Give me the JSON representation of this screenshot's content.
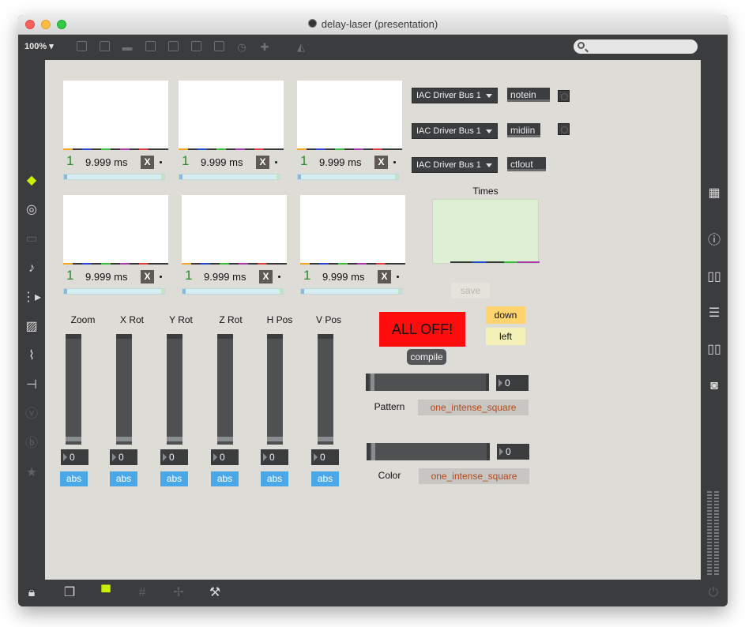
{
  "window": {
    "title": "delay-laser (presentation)",
    "zoom": "100%"
  },
  "toolbar": {
    "icons": [
      "presentation-icon",
      "text-icon",
      "comment-icon",
      "object-x-icon",
      "circle-icon",
      "play-icon",
      "dash-icon",
      "dial-icon",
      "plus-icon",
      "paint-bucket-icon"
    ]
  },
  "search": {
    "placeholder": ""
  },
  "leftbar": {
    "icons": [
      "cube-icon",
      "target-icon",
      "rack-icon",
      "note-icon",
      "sequencer-icon",
      "image-icon",
      "paperclip-icon",
      "plug-icon",
      "v-icon",
      "b-icon",
      "star-icon"
    ]
  },
  "rightbar": {
    "icons": [
      "grid-icon",
      "info-icon",
      "book-open-icon",
      "list-icon",
      "book-icon",
      "camera-icon"
    ]
  },
  "bottombar": {
    "icons": [
      "lock-icon",
      "windows-icon",
      "presentation-mode-icon",
      "grid-icon",
      "cursor-plus-icon",
      "wrench-icon",
      "power-icon"
    ]
  },
  "scopes": [
    {
      "num": "1",
      "ms": "9.999 ms",
      "x": "X"
    },
    {
      "num": "1",
      "ms": "9.999 ms",
      "x": "X"
    },
    {
      "num": "1",
      "ms": "9.999 ms",
      "x": "X"
    },
    {
      "num": "1",
      "ms": "9.999 ms",
      "x": "X"
    },
    {
      "num": "1",
      "ms": "9.999 ms",
      "x": "X"
    },
    {
      "num": "1",
      "ms": "9.999 ms",
      "x": "X"
    }
  ],
  "midi": {
    "rows": [
      {
        "device": "IAC Driver Bus 1",
        "object": "notein"
      },
      {
        "device": "IAC Driver Bus 1",
        "object": "midiin"
      },
      {
        "device": "IAC Driver Bus 1",
        "object": "ctlout"
      }
    ]
  },
  "times": {
    "label": "Times"
  },
  "buttons": {
    "save": "save",
    "all_off": "ALL OFF!",
    "compile": "compile",
    "down": "down",
    "left": "left"
  },
  "sliders": [
    {
      "label": "Zoom",
      "value": "0",
      "mode": "abs"
    },
    {
      "label": "X Rot",
      "value": "0",
      "mode": "abs"
    },
    {
      "label": "Y Rot",
      "value": "0",
      "mode": "abs"
    },
    {
      "label": "Z Rot",
      "value": "0",
      "mode": "abs"
    },
    {
      "label": "H Pos",
      "value": "0",
      "mode": "abs"
    },
    {
      "label": "V Pos",
      "value": "0",
      "mode": "abs"
    }
  ],
  "pattern": {
    "label": "Pattern",
    "value": "0",
    "selection": "one_intense_square"
  },
  "color": {
    "label": "Color",
    "value": "0",
    "selection": "one_intense_square"
  },
  "colors": {
    "all_off": "#ff0d0d",
    "abs": "#4ba8e8",
    "down": "#ffd46e",
    "left": "#f3f1b8",
    "menu_text": "#b54818",
    "canvas": "#dedcd7",
    "accent_cube": "#c8f000"
  }
}
